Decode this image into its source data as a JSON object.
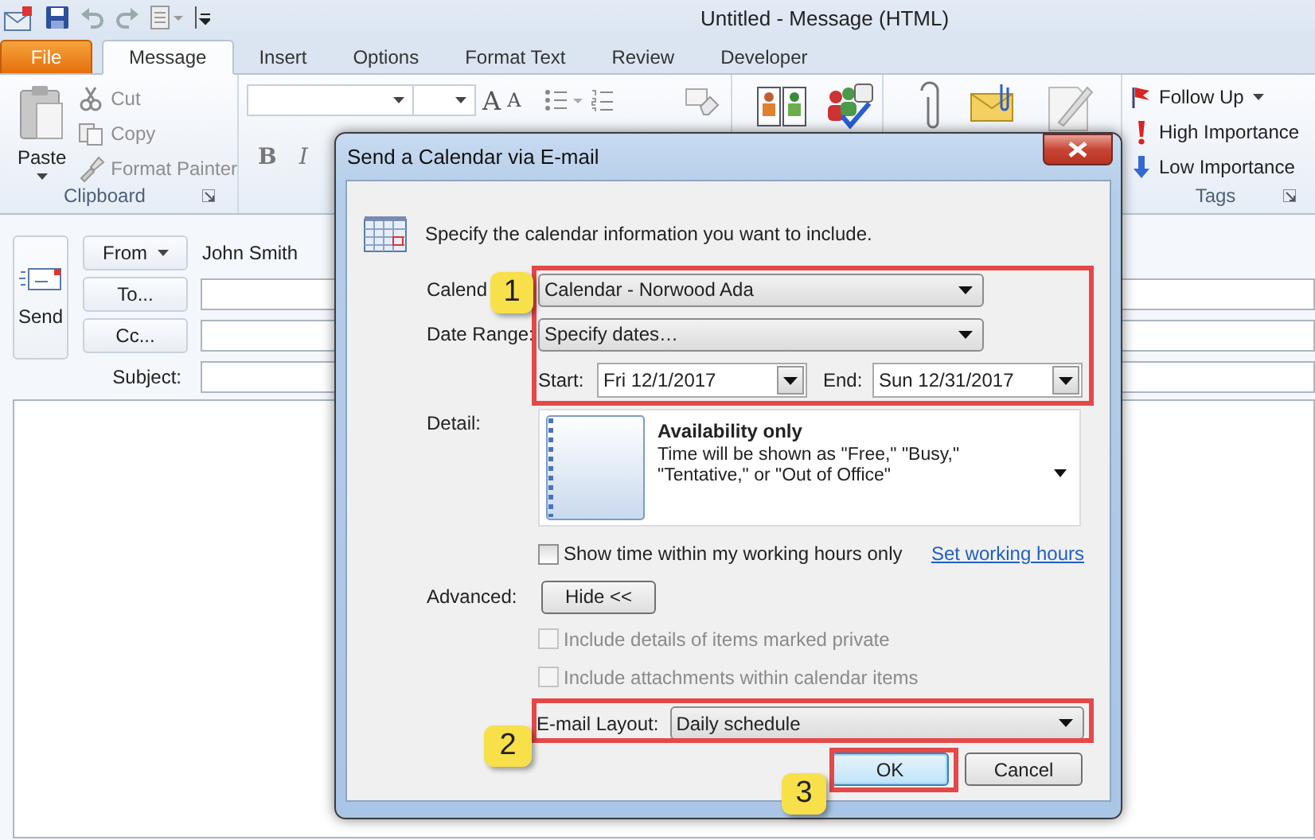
{
  "window": {
    "title": "Untitled  -  Message (HTML)"
  },
  "ribbon_tabs": [
    {
      "label": "File",
      "kind": "file",
      "selected": false
    },
    {
      "label": "Message",
      "kind": "tab",
      "selected": true
    },
    {
      "label": "Insert",
      "kind": "tab",
      "selected": false
    },
    {
      "label": "Options",
      "kind": "tab",
      "selected": false
    },
    {
      "label": "Format Text",
      "kind": "tab",
      "selected": false
    },
    {
      "label": "Review",
      "kind": "tab",
      "selected": false
    },
    {
      "label": "Developer",
      "kind": "tab",
      "selected": false
    }
  ],
  "clipboard": {
    "paste": "Paste",
    "group_label": "Clipboard",
    "items": [
      {
        "label": "Cut",
        "kind": "cut",
        "disabled": true
      },
      {
        "label": "Copy",
        "kind": "copy",
        "disabled": true
      },
      {
        "label": "Format Painter",
        "kind": "painter",
        "disabled": true
      }
    ]
  },
  "basic_text": {
    "grow": "A",
    "shrink": "A",
    "bold": "B",
    "italic": "I"
  },
  "tags": {
    "group_label": "Tags",
    "items": [
      {
        "label": "Follow Up",
        "kind": "flag",
        "dropdown": true
      },
      {
        "label": "High Importance",
        "kind": "high",
        "dropdown": false
      },
      {
        "label": "Low Importance",
        "kind": "low",
        "dropdown": false
      }
    ]
  },
  "compose": {
    "send": "Send",
    "from_button": "From",
    "from_value": "John Smith",
    "to_button": "To...",
    "cc_button": "Cc...",
    "subject_label": "Subject:"
  },
  "dialog": {
    "title": "Send a Calendar via E-mail",
    "intro": "Specify the calendar information you want to include.",
    "calendar_label": "Calend",
    "calendar_value": "Calendar - Norwood Ada",
    "range_label": "Date Range:",
    "range_value": "Specify dates…",
    "start_label": "Start:",
    "start_value": "Fri 12/1/2017",
    "end_label": "End:",
    "end_value": "Sun 12/31/2017",
    "detail_label": "Detail:",
    "detail_title": "Availability only",
    "detail_text": "Time will be shown as \"Free,\" \"Busy,\" \"Tentative,\" or \"Out of Office\"",
    "working_hours": {
      "label": "Show time within my working hours only",
      "checked": false,
      "link": "Set working hours"
    },
    "advanced_label": "Advanced:",
    "advanced_button": "Hide <<",
    "advanced_options": [
      {
        "label": "Include details of items marked private",
        "checked": false,
        "disabled": true
      },
      {
        "label": "Include attachments within calendar items",
        "checked": false,
        "disabled": true
      }
    ],
    "layout_label": "E-mail Layout:",
    "layout_value": "Daily schedule",
    "buttons": [
      {
        "label": "OK",
        "default": true
      },
      {
        "label": "Cancel",
        "default": false
      }
    ]
  },
  "callouts": [
    {
      "number": "1"
    },
    {
      "number": "2"
    },
    {
      "number": "3"
    }
  ]
}
